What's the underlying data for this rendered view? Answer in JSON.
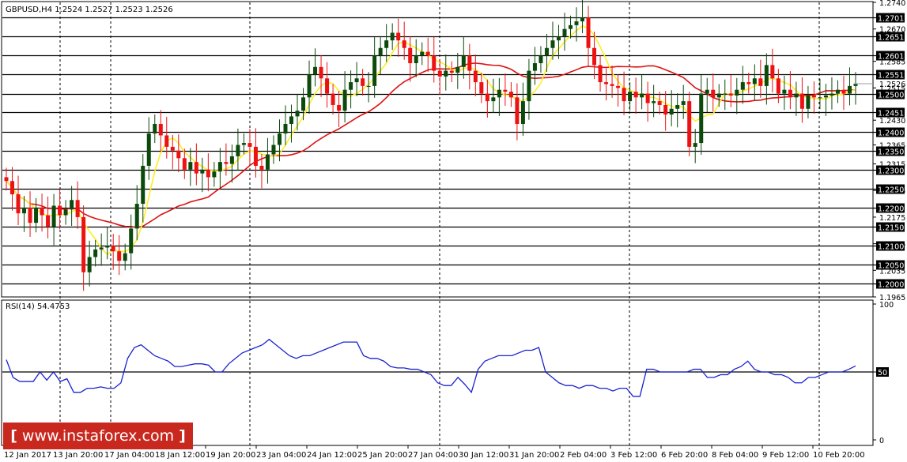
{
  "chart_data": [
    {
      "type": "candlestick",
      "symbol": "GBPUSD,H4",
      "header": "GBPUSD,H4  1.2524 1.2527 1.2523 1.2526",
      "last_price": "1.2526",
      "ylim": [
        1.1965,
        1.274
      ],
      "price_ticks": [
        "1.2740",
        "1.2670",
        "1.2585",
        "1.2515",
        "1.2430",
        "1.2365",
        "1.2315",
        "1.2245",
        "1.2175",
        "1.2105",
        "1.2035",
        "1.1965"
      ],
      "levels": [
        "1.2701",
        "1.2651",
        "1.2601",
        "1.2551",
        "1.2500",
        "1.2451",
        "1.2400",
        "1.2350",
        "1.2300",
        "1.2250",
        "1.2200",
        "1.2150",
        "1.2100",
        "1.2050",
        "1.2000"
      ],
      "x_labels": [
        "12 Jan 2017",
        "13 Jan 20:00",
        "17 Jan 04:00",
        "18 Jan 12:00",
        "19 Jan 20:00",
        "23 Jan 04:00",
        "24 Jan 12:00",
        "25 Jan 20:00",
        "27 Jan 04:00",
        "30 Jan 12:00",
        "31 Jan 20:00",
        "2 Feb 04:00",
        "3 Feb 12:00",
        "6 Feb 20:00",
        "8 Feb 04:00",
        "9 Feb 12:00",
        "10 Feb 20:00"
      ],
      "grid": "vertical dashed",
      "colors": {
        "bull": "#0c4a0c",
        "bear": "#ee1111",
        "ma_fast": "#ffee22",
        "ma_slow": "#dd1111",
        "level": "#000000"
      },
      "closes": [
        1.227,
        1.2235,
        1.2185,
        1.22,
        1.216,
        1.22,
        1.218,
        1.215,
        1.2205,
        1.218,
        1.2195,
        1.222,
        1.2175,
        1.203,
        1.207,
        1.209,
        1.2095,
        1.21,
        1.2085,
        1.206,
        1.208,
        1.2145,
        1.221,
        1.231,
        1.2395,
        1.242,
        1.239,
        1.236,
        1.235,
        1.233,
        1.23,
        1.232,
        1.229,
        1.23,
        1.228,
        1.2295,
        1.232,
        1.2315,
        1.2335,
        1.2365,
        1.237,
        1.236,
        1.231,
        1.23,
        1.234,
        1.2365,
        1.2395,
        1.242,
        1.244,
        1.2455,
        1.249,
        1.255,
        1.257,
        1.254,
        1.25,
        1.247,
        1.2455,
        1.251,
        1.253,
        1.254,
        1.252,
        1.252,
        1.26,
        1.262,
        1.264,
        1.266,
        1.264,
        1.262,
        1.258,
        1.26,
        1.261,
        1.26,
        1.256,
        1.2545,
        1.256,
        1.2555,
        1.257,
        1.26,
        1.256,
        1.253,
        1.25,
        1.248,
        1.249,
        1.251,
        1.2505,
        1.249,
        1.242,
        1.248,
        1.256,
        1.258,
        1.26,
        1.262,
        1.264,
        1.265,
        1.267,
        1.268,
        1.269,
        1.27,
        1.262,
        1.2575,
        1.253,
        1.2525,
        1.252,
        1.2515,
        1.248,
        1.2505,
        1.249,
        1.25,
        1.2475,
        1.248,
        1.247,
        1.2445,
        1.246,
        1.247,
        1.248,
        1.236,
        1.237,
        1.25,
        1.251,
        1.249,
        1.25,
        1.25,
        1.2495,
        1.251,
        1.253,
        1.2525,
        1.254,
        1.252,
        1.2575,
        1.254,
        1.25,
        1.251,
        1.249,
        1.25,
        1.246,
        1.2495,
        1.249,
        1.249,
        1.2495,
        1.25,
        1.251,
        1.25,
        1.252,
        1.2526
      ],
      "rsi": {
        "label": "RSI(14) 54.4753",
        "ylim": [
          0,
          100
        ],
        "ticks": [
          "100",
          "50",
          "0"
        ],
        "level": "50",
        "color": "#1a23d0",
        "values": [
          59,
          46,
          43,
          43,
          43,
          50,
          44,
          50,
          43,
          45,
          35,
          35,
          38,
          38,
          39,
          38,
          38,
          42,
          60,
          68,
          70,
          66,
          62,
          60,
          58,
          54,
          54,
          55,
          56,
          56,
          55,
          50,
          50,
          56,
          60,
          64,
          66,
          68,
          70,
          74,
          70,
          66,
          62,
          60,
          62,
          62,
          64,
          66,
          68,
          70,
          72,
          72,
          72,
          62,
          60,
          60,
          58,
          54,
          53,
          53,
          52,
          52,
          50,
          48,
          42,
          40,
          40,
          46,
          41,
          35,
          52,
          58,
          60,
          62,
          62,
          62,
          64,
          66,
          66,
          68,
          50,
          46,
          42,
          40,
          40,
          38,
          40,
          40,
          38,
          38,
          36,
          38,
          38,
          32,
          32,
          52,
          52,
          50,
          50,
          50,
          50,
          50,
          52,
          52,
          46,
          46,
          48,
          48,
          52,
          54,
          58,
          52,
          50,
          50,
          48,
          48,
          46,
          42,
          42,
          46,
          46,
          48,
          50,
          50,
          50,
          52,
          54.4753
        ]
      }
    }
  ],
  "watermark": {
    "open": "[",
    "text": "www.instaforex.com",
    "close": "]"
  }
}
